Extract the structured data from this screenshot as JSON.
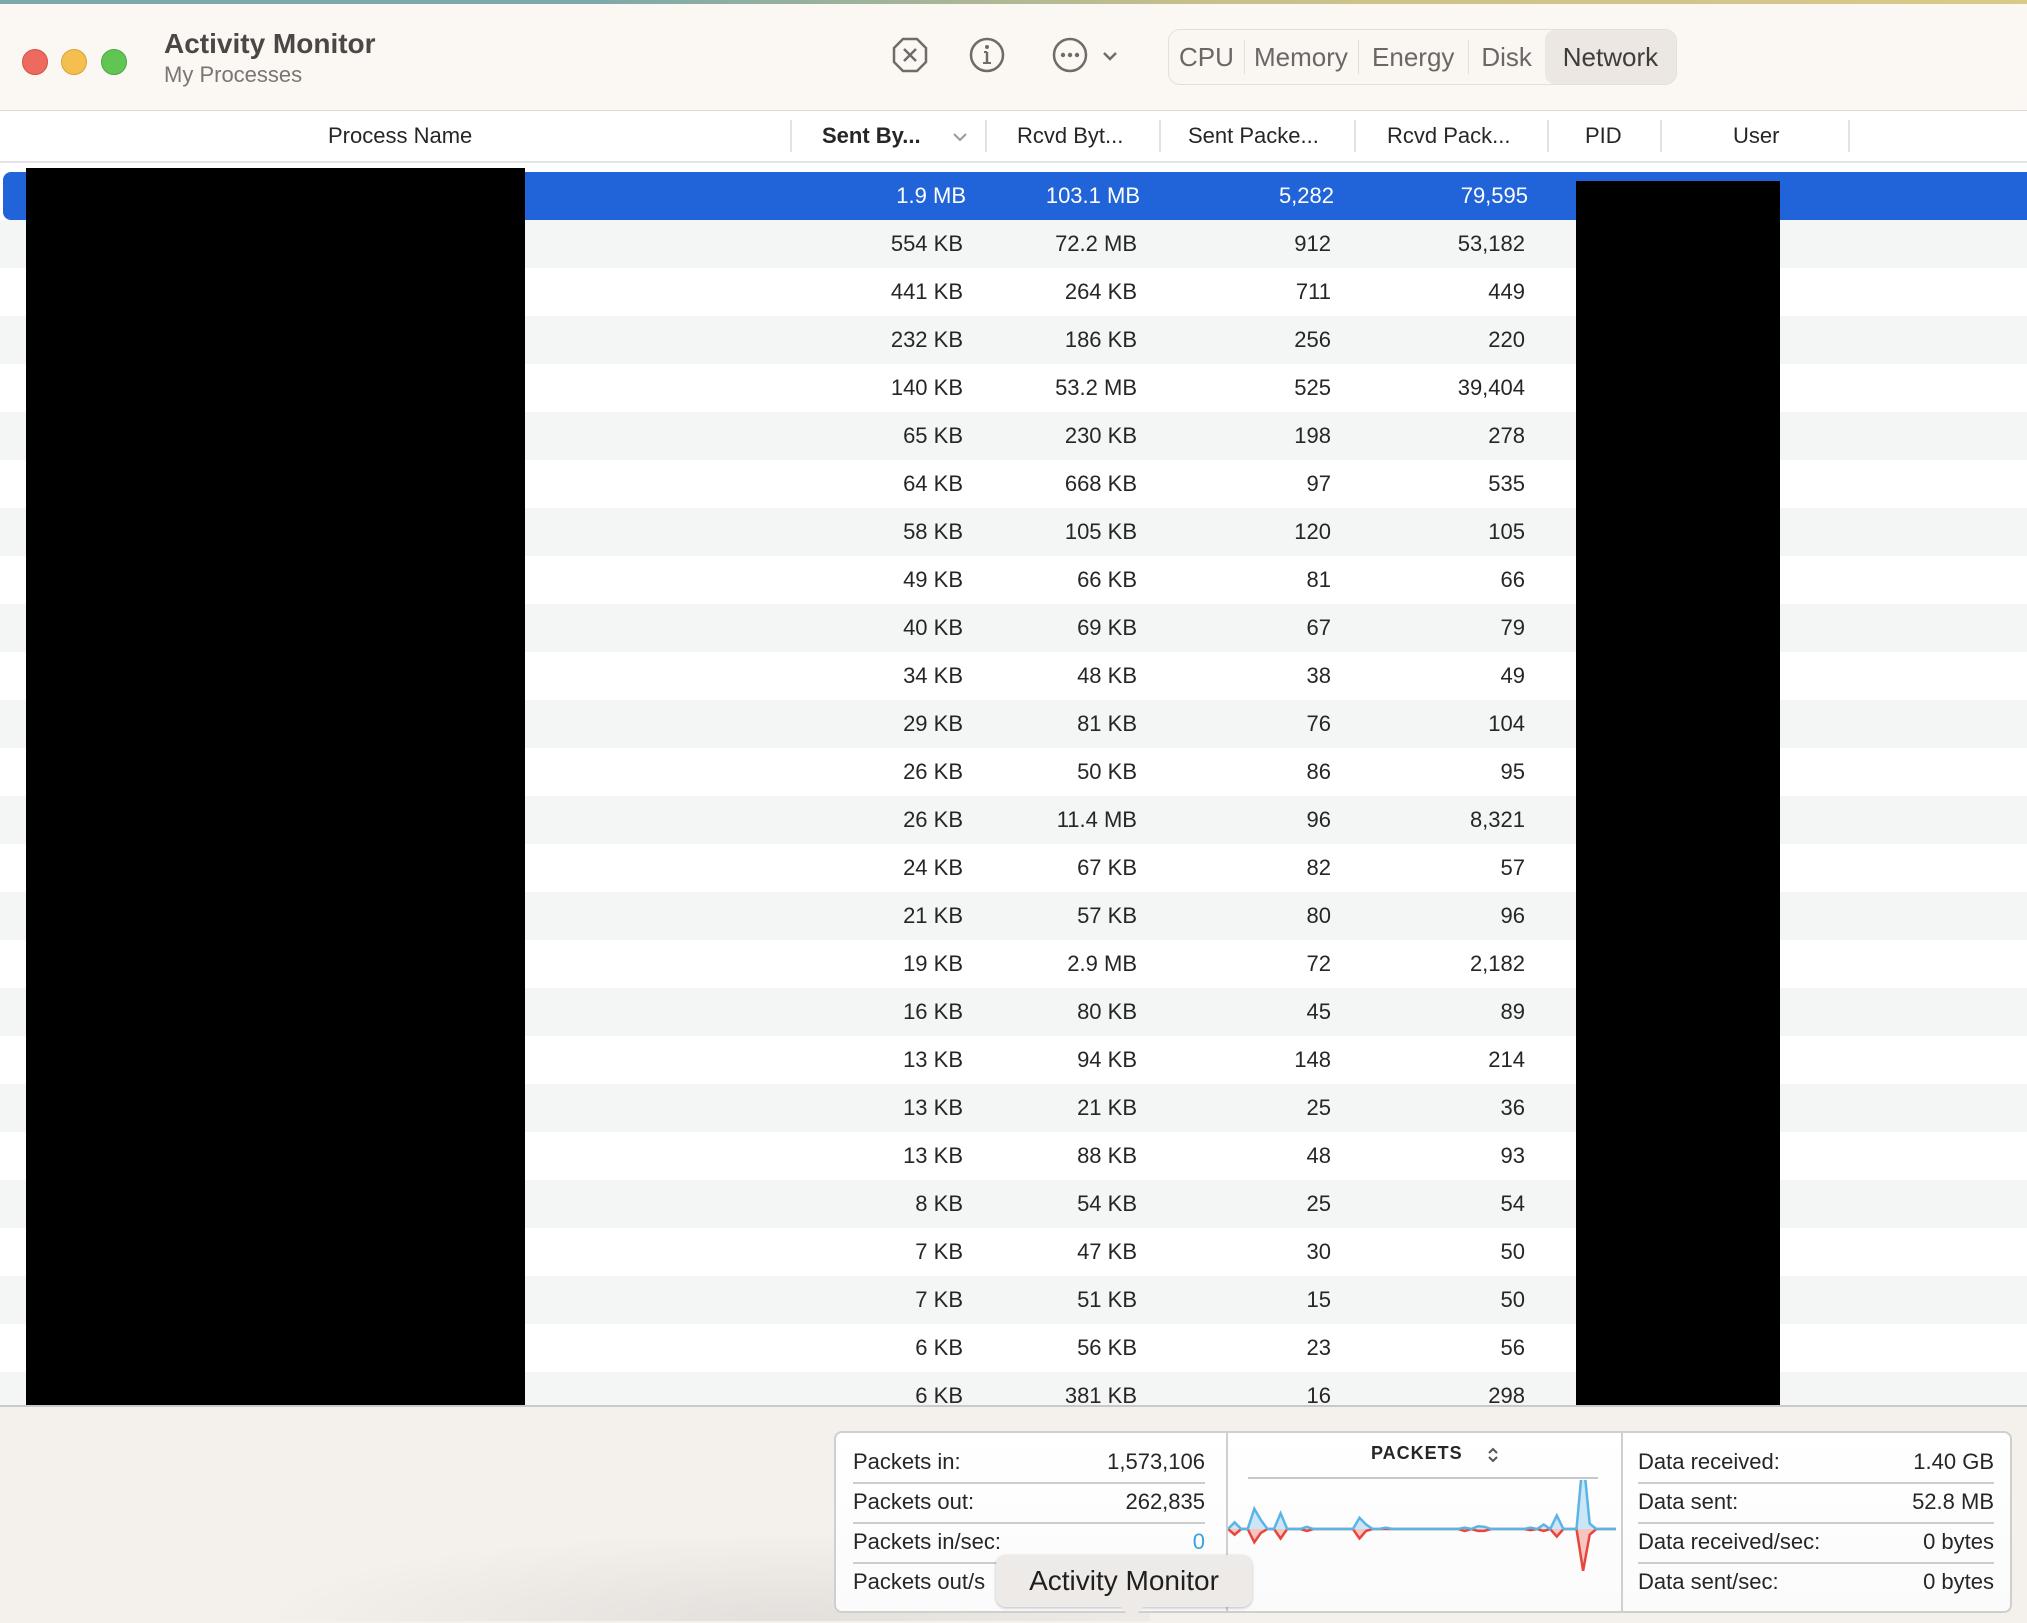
{
  "window": {
    "title": "Activity Monitor",
    "subtitle": "My Processes"
  },
  "toolbar": {
    "stop_icon": "stop-process-icon",
    "info_icon": "info-icon",
    "more_icon": "more-options-icon",
    "tabs": [
      {
        "label": "CPU",
        "active": false
      },
      {
        "label": "Memory",
        "active": false
      },
      {
        "label": "Energy",
        "active": false
      },
      {
        "label": "Disk",
        "active": false
      },
      {
        "label": "Network",
        "active": true
      }
    ]
  },
  "table": {
    "columns": {
      "process_name": "Process Name",
      "sent_bytes": "Sent By...",
      "rcvd_bytes": "Rcvd Byt...",
      "sent_packets": "Sent Packe...",
      "rcvd_packets": "Rcvd Pack...",
      "pid": "PID",
      "user": "User"
    },
    "sort_column": "sent_bytes",
    "sort_direction": "descending",
    "selected_row": 0,
    "rows": [
      {
        "sent_bytes": "1.9 MB",
        "rcvd_bytes": "103.1 MB",
        "sent_packets": "5,282",
        "rcvd_packets": "79,595"
      },
      {
        "sent_bytes": "554 KB",
        "rcvd_bytes": "72.2 MB",
        "sent_packets": "912",
        "rcvd_packets": "53,182"
      },
      {
        "sent_bytes": "441 KB",
        "rcvd_bytes": "264 KB",
        "sent_packets": "711",
        "rcvd_packets": "449"
      },
      {
        "sent_bytes": "232 KB",
        "rcvd_bytes": "186 KB",
        "sent_packets": "256",
        "rcvd_packets": "220"
      },
      {
        "sent_bytes": "140 KB",
        "rcvd_bytes": "53.2 MB",
        "sent_packets": "525",
        "rcvd_packets": "39,404"
      },
      {
        "sent_bytes": "65 KB",
        "rcvd_bytes": "230 KB",
        "sent_packets": "198",
        "rcvd_packets": "278"
      },
      {
        "sent_bytes": "64 KB",
        "rcvd_bytes": "668 KB",
        "sent_packets": "97",
        "rcvd_packets": "535"
      },
      {
        "sent_bytes": "58 KB",
        "rcvd_bytes": "105 KB",
        "sent_packets": "120",
        "rcvd_packets": "105"
      },
      {
        "sent_bytes": "49 KB",
        "rcvd_bytes": "66 KB",
        "sent_packets": "81",
        "rcvd_packets": "66"
      },
      {
        "sent_bytes": "40 KB",
        "rcvd_bytes": "69 KB",
        "sent_packets": "67",
        "rcvd_packets": "79"
      },
      {
        "sent_bytes": "34 KB",
        "rcvd_bytes": "48 KB",
        "sent_packets": "38",
        "rcvd_packets": "49"
      },
      {
        "sent_bytes": "29 KB",
        "rcvd_bytes": "81 KB",
        "sent_packets": "76",
        "rcvd_packets": "104"
      },
      {
        "sent_bytes": "26 KB",
        "rcvd_bytes": "50 KB",
        "sent_packets": "86",
        "rcvd_packets": "95"
      },
      {
        "sent_bytes": "26 KB",
        "rcvd_bytes": "11.4 MB",
        "sent_packets": "96",
        "rcvd_packets": "8,321"
      },
      {
        "sent_bytes": "24 KB",
        "rcvd_bytes": "67 KB",
        "sent_packets": "82",
        "rcvd_packets": "57"
      },
      {
        "sent_bytes": "21 KB",
        "rcvd_bytes": "57 KB",
        "sent_packets": "80",
        "rcvd_packets": "96"
      },
      {
        "sent_bytes": "19 KB",
        "rcvd_bytes": "2.9 MB",
        "sent_packets": "72",
        "rcvd_packets": "2,182"
      },
      {
        "sent_bytes": "16 KB",
        "rcvd_bytes": "80 KB",
        "sent_packets": "45",
        "rcvd_packets": "89"
      },
      {
        "sent_bytes": "13 KB",
        "rcvd_bytes": "94 KB",
        "sent_packets": "148",
        "rcvd_packets": "214"
      },
      {
        "sent_bytes": "13 KB",
        "rcvd_bytes": "21 KB",
        "sent_packets": "25",
        "rcvd_packets": "36"
      },
      {
        "sent_bytes": "13 KB",
        "rcvd_bytes": "88 KB",
        "sent_packets": "48",
        "rcvd_packets": "93"
      },
      {
        "sent_bytes": "8 KB",
        "rcvd_bytes": "54 KB",
        "sent_packets": "25",
        "rcvd_packets": "54"
      },
      {
        "sent_bytes": "7 KB",
        "rcvd_bytes": "47 KB",
        "sent_packets": "30",
        "rcvd_packets": "50"
      },
      {
        "sent_bytes": "7 KB",
        "rcvd_bytes": "51 KB",
        "sent_packets": "15",
        "rcvd_packets": "50"
      },
      {
        "sent_bytes": "6 KB",
        "rcvd_bytes": "56 KB",
        "sent_packets": "23",
        "rcvd_packets": "56"
      },
      {
        "sent_bytes": "6 KB",
        "rcvd_bytes": "381 KB",
        "sent_packets": "16",
        "rcvd_packets": "298"
      }
    ]
  },
  "summary": {
    "packets": [
      {
        "label": "Packets in:",
        "value": "1,573,106"
      },
      {
        "label": "Packets out:",
        "value": "262,835"
      },
      {
        "label": "Packets in/sec:",
        "value": "0",
        "highlight": true
      },
      {
        "label": "Packets out/s",
        "value": ""
      }
    ],
    "graph": {
      "title": "PACKETS",
      "in_color": "#5ab4e8",
      "out_color": "#e8453c",
      "in_series": [
        0,
        0.15,
        0,
        0,
        0.45,
        0.2,
        0,
        0,
        0.35,
        0,
        0,
        0,
        0.05,
        0,
        0,
        0,
        0,
        0,
        0,
        0,
        0.25,
        0.1,
        0,
        0,
        0.03,
        0,
        0,
        0,
        0,
        0,
        0,
        0,
        0,
        0,
        0,
        0,
        0.03,
        0,
        0.06,
        0.05,
        0,
        0,
        0,
        0,
        0,
        0,
        0.03,
        0,
        0.1,
        0,
        0.3,
        0,
        0,
        0,
        1.6,
        0.12,
        0,
        0,
        0,
        0
      ],
      "out_series": [
        0,
        0.15,
        0,
        0,
        0.35,
        0.1,
        0,
        0,
        0.25,
        0,
        0,
        0,
        0.05,
        0,
        0,
        0,
        0,
        0,
        0,
        0,
        0.25,
        0.05,
        0,
        0,
        0,
        0,
        0,
        0,
        0,
        0,
        0,
        0,
        0,
        0,
        0,
        0,
        0.05,
        0,
        0.05,
        0.05,
        0,
        0,
        0,
        0,
        0,
        0,
        0.03,
        0,
        0.05,
        0,
        0.2,
        0,
        0,
        0,
        1.1,
        0.15,
        0,
        0,
        0,
        0
      ]
    },
    "data": [
      {
        "label": "Data received:",
        "value": "1.40 GB"
      },
      {
        "label": "Data sent:",
        "value": "52.8 MB"
      },
      {
        "label": "Data received/sec:",
        "value": "0 bytes"
      },
      {
        "label": "Data sent/sec:",
        "value": "0 bytes"
      }
    ]
  },
  "tooltip": {
    "text": "Activity Monitor"
  }
}
